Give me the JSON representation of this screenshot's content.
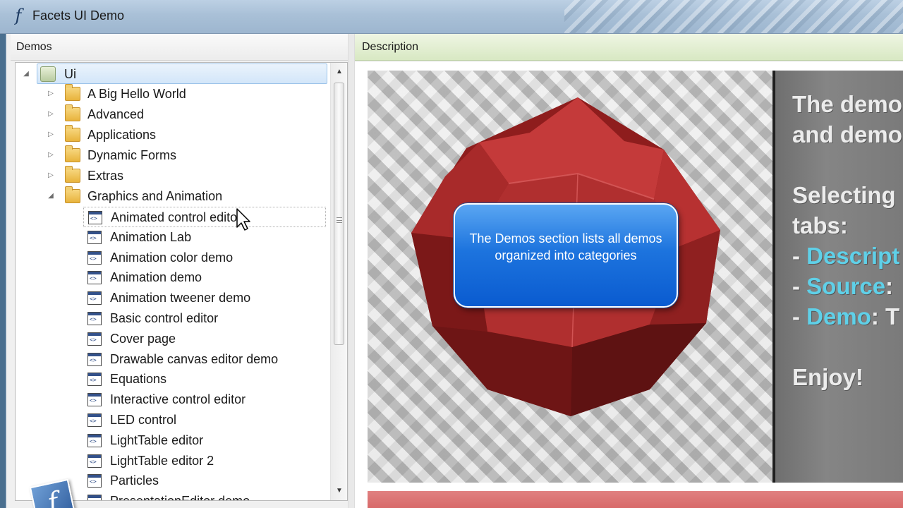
{
  "window": {
    "title": "Facets UI Demo"
  },
  "demos_panel": {
    "header": "Demos",
    "tree": {
      "root": "Ui",
      "folders": [
        {
          "label": "A Big Hello World",
          "expanded": false
        },
        {
          "label": "Advanced",
          "expanded": false
        },
        {
          "label": "Applications",
          "expanded": false
        },
        {
          "label": "Dynamic Forms",
          "expanded": false
        },
        {
          "label": "Extras",
          "expanded": false
        },
        {
          "label": "Graphics and Animation",
          "expanded": true
        }
      ],
      "items": [
        "Animated control editor",
        "Animation Lab",
        "Animation color demo",
        "Animation demo",
        "Animation tweener demo",
        "Basic control editor",
        "Cover page",
        "Drawable canvas editor demo",
        "Equations",
        "Interactive control editor",
        "LED control",
        "LightTable editor",
        "LightTable editor 2",
        "Particles",
        "PresentationEditor demo"
      ],
      "hovered_item": "Animated control editor"
    }
  },
  "description_panel": {
    "header": "Description",
    "callout": "The Demos section lists all demos organized into categories",
    "slide_lines": [
      {
        "prefix": "",
        "accent": "",
        "suffix": "The demo"
      },
      {
        "prefix": "",
        "accent": "",
        "suffix": "and demo"
      },
      {
        "prefix": "",
        "accent": "",
        "suffix": ""
      },
      {
        "prefix": "",
        "accent": "",
        "suffix": "Selecting"
      },
      {
        "prefix": "",
        "accent": "",
        "suffix": "tabs:"
      },
      {
        "prefix": "- ",
        "accent": "Descript",
        "suffix": ""
      },
      {
        "prefix": "- ",
        "accent": "Source",
        "suffix": ":"
      },
      {
        "prefix": "- ",
        "accent": "Demo",
        "suffix": ": T"
      },
      {
        "prefix": "",
        "accent": "",
        "suffix": ""
      },
      {
        "prefix": "",
        "accent": "",
        "suffix": "Enjoy!"
      }
    ]
  },
  "icons": {
    "app": "facets-logo-icon",
    "folder": "folder-icon",
    "demo": "demo-document-icon",
    "logo_glyph": "f"
  },
  "colors": {
    "accent_text": "#5fd0e8",
    "callout_blue": "#1d74de",
    "selection": "#d3e6f9"
  }
}
